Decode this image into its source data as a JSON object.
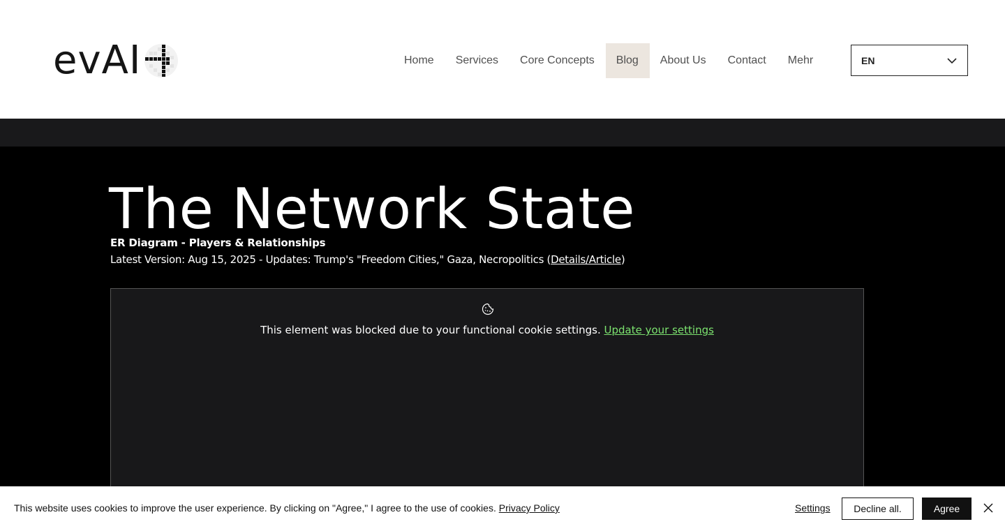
{
  "header": {
    "logo_text": "evAI",
    "nav": [
      {
        "label": "Home"
      },
      {
        "label": "Services"
      },
      {
        "label": "Core Concepts"
      },
      {
        "label": "Blog",
        "active": true
      },
      {
        "label": "About Us"
      },
      {
        "label": "Contact"
      },
      {
        "label": "Mehr"
      }
    ],
    "language": {
      "selected": "EN",
      "icon": "chevron-down-icon"
    }
  },
  "page": {
    "title": "The Network State",
    "subtitle": "ER Diagram - Players & Relationships",
    "version_text": "Latest Version: Aug 15, 2025  - Updates: Trump's \"Freedom Cities,\" Gaza, Necropolitics (",
    "version_link": "Details/Article",
    "version_close": ")"
  },
  "blocked_element": {
    "icon": "cookie-icon",
    "message": "This element was blocked due to your functional cookie settings.",
    "link": "Update your settings",
    "link_color": "#7ce36f"
  },
  "cookie_banner": {
    "message": "This website uses cookies to improve the user experience. By clicking on \"Agree,\" I agree to the use of cookies.",
    "privacy_link": "Privacy Policy",
    "settings": "Settings",
    "decline": "Decline all.",
    "agree": "Agree",
    "close_icon": "close-icon"
  },
  "colors": {
    "nav_active_bg": "#ece6df",
    "page_bg": "#000000",
    "band_bg": "#19191b",
    "box_bg": "#18181a",
    "link_green": "#7ce36f"
  }
}
